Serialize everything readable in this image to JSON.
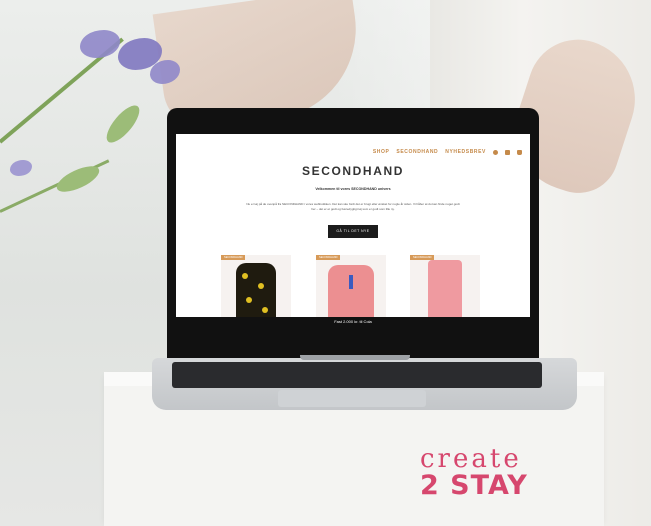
{
  "site": {
    "nav": [
      "SHOP",
      "SECONDHAND",
      "NYHEDSBREV"
    ],
    "title": "SECONDHAND",
    "welcome": "Velkommen til vores SECONDHAND univers",
    "description": "Nu er tøj på de ovenpå fra SECONDHAND i vores webbutikken. Det kan ske fordi det er brugt eller ønsket for nogle år siden. Vi håber at du kan finde noget godt her – det er et godt og bæredygtigt tøj som er godt som lille ny.",
    "cta": "GÅ TIL DET NYE",
    "badges": [
      "SECONDHAND",
      "SECONDHAND",
      "SECONDHAND"
    ],
    "banner": "Fast 2.000 kr. til Cola"
  },
  "logo": {
    "line1": "create",
    "line2": "2 STAY"
  },
  "colors": {
    "brand_pink": "#d6476e",
    "nav_gold": "#c58a4a"
  }
}
